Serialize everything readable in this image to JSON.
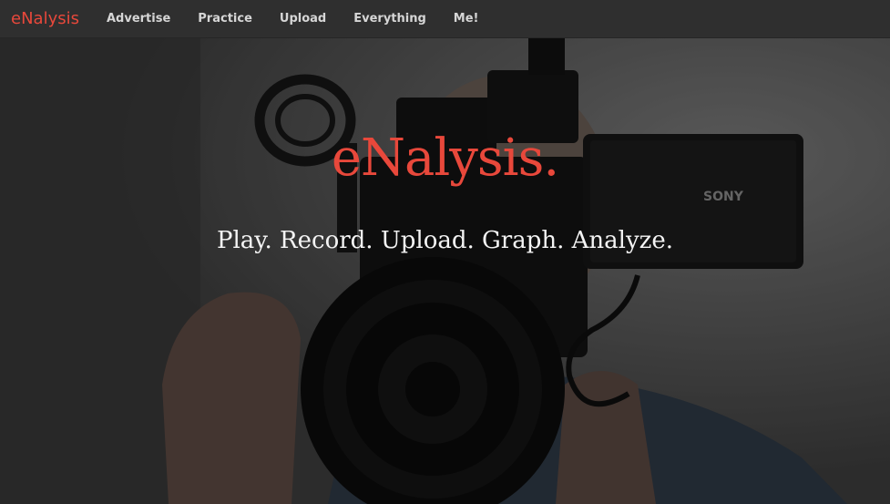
{
  "navbar": {
    "brand": "eNalysis",
    "items": [
      {
        "label": "Advertise"
      },
      {
        "label": "Practice"
      },
      {
        "label": "Upload"
      },
      {
        "label": "Everything"
      },
      {
        "label": "Me!"
      }
    ]
  },
  "hero": {
    "title": "eNalysis.",
    "tagline": "Play. Record. Upload. Graph. Analyze.",
    "camera_brand": "SONY"
  },
  "colors": {
    "accent": "#e8483b",
    "navbar_bg": "#2f2f2f",
    "nav_text": "#d6d6d6",
    "tagline_text": "#f4f4f4"
  }
}
